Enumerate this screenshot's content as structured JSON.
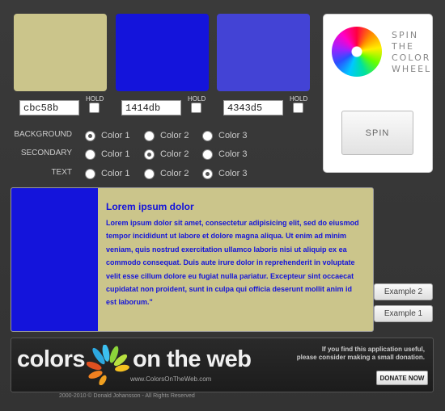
{
  "swatches": [
    {
      "color": "#cbc58b",
      "hex": "cbc58b",
      "hold_label": "HOLD"
    },
    {
      "color": "#1414db",
      "hex": "1414db",
      "hold_label": "HOLD"
    },
    {
      "color": "#4343d5",
      "hex": "4343d5",
      "hold_label": "HOLD"
    }
  ],
  "assignments": {
    "rows": [
      {
        "label": "BACKGROUND",
        "selected": 0
      },
      {
        "label": "SECONDARY",
        "selected": 1
      },
      {
        "label": "TEXT",
        "selected": 2
      }
    ],
    "options": [
      "Color 1",
      "Color 2",
      "Color 3"
    ]
  },
  "spin_panel": {
    "title_lines": [
      "SPIN",
      "THE",
      "COLOR",
      "WHEEL"
    ],
    "button_label": "SPIN"
  },
  "preview": {
    "heading": "Lorem ipsum dolor",
    "body": "Lorem ipsum dolor sit amet, consectetur adipisicing elit, sed do eiusmod tempor incididunt ut labore et dolore magna aliqua. Ut enim ad minim veniam, quis nostrud exercitation ullamco laboris nisi ut aliquip ex ea commodo consequat. Duis aute irure dolor in reprehenderit in voluptate velit esse cillum dolore eu fugiat nulla pariatur. Excepteur sint occaecat cupidatat non proident, sunt in culpa qui officia deserunt mollit anim id est laborum.\""
  },
  "examples": [
    "Example 2",
    "Example 1"
  ],
  "footer": {
    "logo_left": "colors",
    "logo_right": "on the web",
    "logo_url": "www.ColorsOnTheWeb.com",
    "donate_text_line1": "If you find this application useful,",
    "donate_text_line2": "please consider making a small donation.",
    "donate_button": "DONATE NOW",
    "copyright": "2000-2010 © Donald Johansson - All Rights Reserved"
  }
}
